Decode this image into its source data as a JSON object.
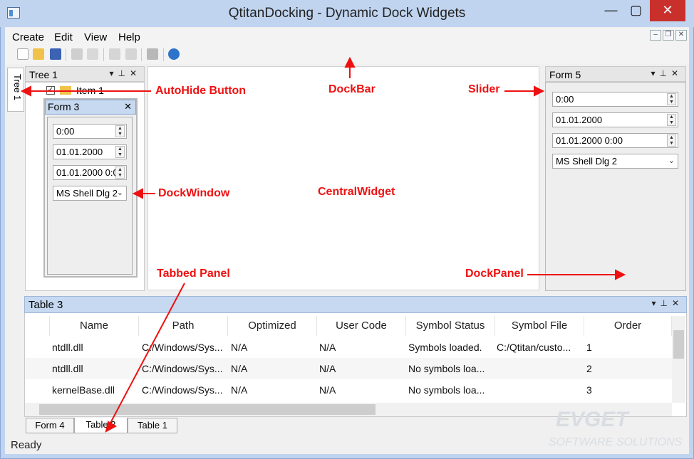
{
  "window": {
    "title": "QtitanDocking - Dynamic Dock Widgets",
    "min": "—",
    "max": "▢",
    "close": "✕"
  },
  "menu": {
    "items": [
      "Create",
      "Edit",
      "View",
      "Help"
    ],
    "mdi_min": "–",
    "mdi_restore": "❐",
    "mdi_close": "✕"
  },
  "toolbar": {
    "icons": [
      "new-icon",
      "open-icon",
      "save-icon",
      "cut-icon",
      "copy-icon",
      "undo-icon",
      "redo-icon",
      "print-icon",
      "help-icon"
    ]
  },
  "left_autohide_tab": "Tree 1",
  "tree1": {
    "title": "Tree 1",
    "item": "Item 1"
  },
  "form3": {
    "title": "Form 3",
    "time": "0:00",
    "date": "01.01.2000",
    "datetime": "01.01.2000 0:0",
    "font": "MS Shell Dlg 2"
  },
  "form5": {
    "title": "Form 5",
    "time": "0:00",
    "date": "01.01.2000",
    "datetime": "01.01.2000 0:00",
    "font": "MS Shell Dlg 2"
  },
  "annotations": {
    "autohide": "AutoHide Button",
    "dockbar": "DockBar",
    "slider": "Slider",
    "dockwindow": "DockWindow",
    "central": "CentralWidget",
    "tabbed": "Tabbed Panel",
    "dockpanel": "DockPanel"
  },
  "table3": {
    "title": "Table 3",
    "columns": [
      "Name",
      "Path",
      "Optimized",
      "User Code",
      "Symbol Status",
      "Symbol File",
      "Order"
    ],
    "rows": [
      [
        "ntdll.dll",
        "C:/Windows/Sys...",
        "N/A",
        "N/A",
        "Symbols loaded.",
        "C:/Qtitan/custo...",
        "1"
      ],
      [
        "ntdll.dll",
        "C:/Windows/Sys...",
        "N/A",
        "N/A",
        "No symbols loa...",
        "",
        "2"
      ],
      [
        "kernelBase.dll",
        "C:/Windows/Sys...",
        "N/A",
        "N/A",
        "No symbols loa...",
        "",
        "3"
      ]
    ]
  },
  "bottom_tabs": [
    "Form 4",
    "Table 3",
    "Table 1"
  ],
  "status": "Ready",
  "watermark": {
    "line1": "EVGET",
    "line2": "SOFTWARE SOLUTIONS"
  }
}
